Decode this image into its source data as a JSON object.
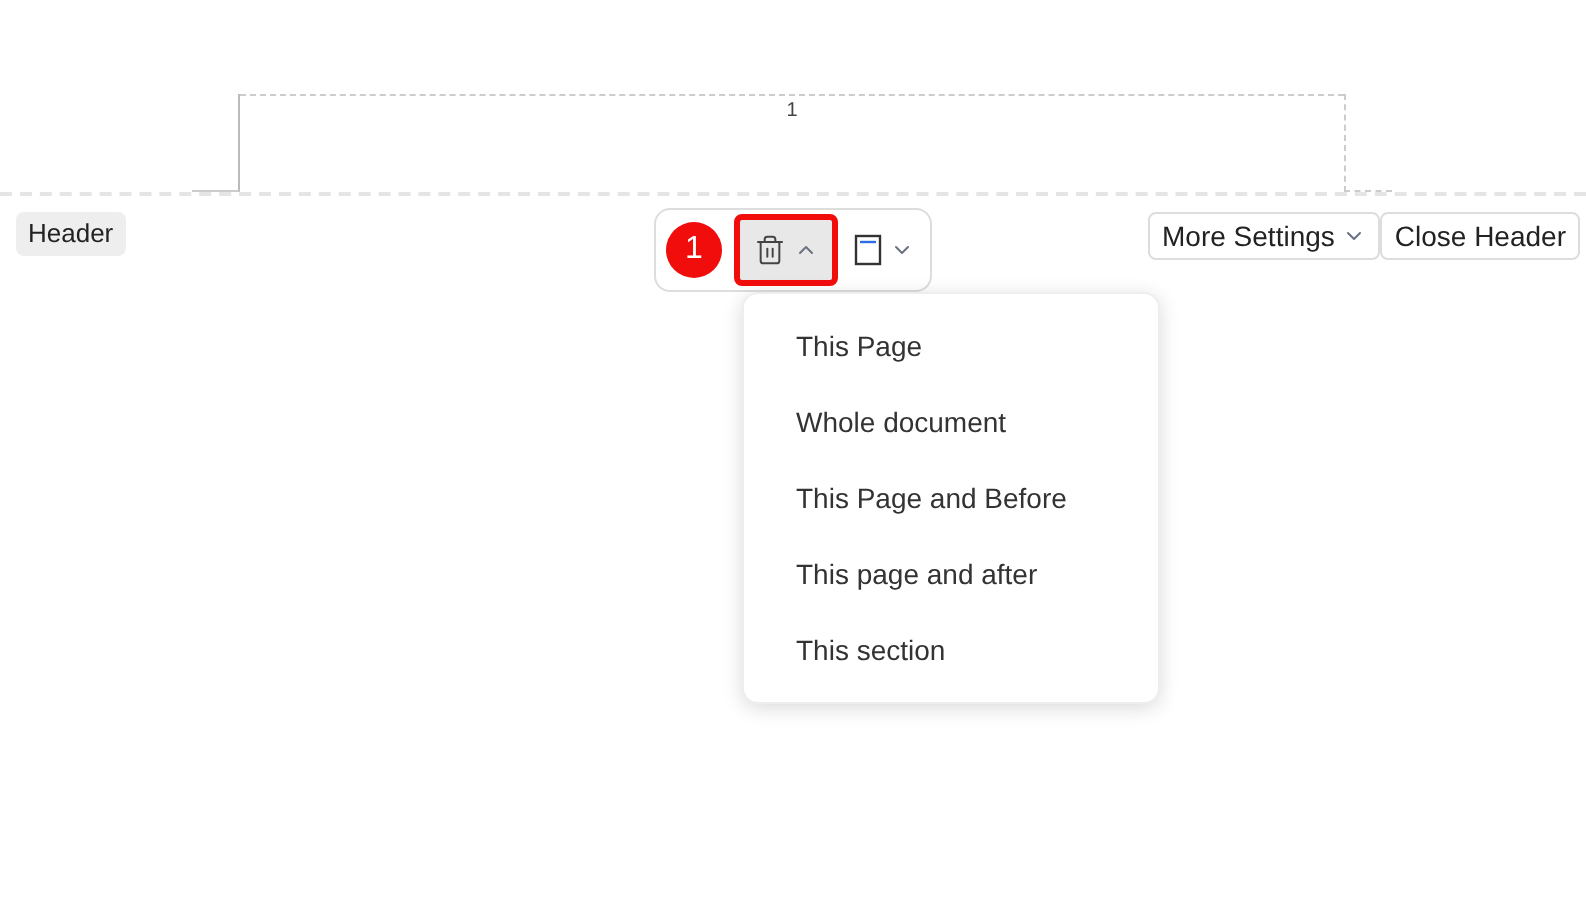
{
  "page": {
    "header_page_number": "1"
  },
  "header_label": "Header",
  "toolbar": {
    "step_badge": "1",
    "delete_button": {
      "expanded": true,
      "highlighted": true
    },
    "layout_button": {
      "expanded": false
    }
  },
  "more_settings": "More Settings",
  "close_header": "Close Header",
  "delete_menu": [
    {
      "label": "This Page"
    },
    {
      "label": "Whole document"
    },
    {
      "label": "This Page and Before"
    },
    {
      "label": "This page and after"
    },
    {
      "label": "This section"
    }
  ]
}
